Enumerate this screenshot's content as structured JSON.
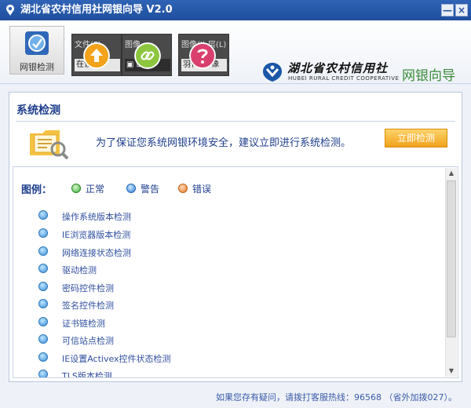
{
  "window": {
    "title": "湖北省农村信用社网银向导 V2.0"
  },
  "title_buttons": {
    "minimize": "—",
    "close": "×"
  },
  "toolbar": {
    "active": {
      "label": "网银检测",
      "icon": "network-check-icon"
    },
    "buttons": [
      {
        "icon": "upload-arrow-icon",
        "color": "#f2a31b",
        "bg_text": "文件(F)",
        "strip_text": "在设置"
      },
      {
        "icon": "link-icon",
        "color": "#8cc63f",
        "bg_text": "图像",
        "strip_text": "▣ ⊡"
      },
      {
        "icon": "help-question-icon",
        "color": "#d9406e",
        "bg_text": "图像(I) 层(L)",
        "strip_text": "羽化: 0 像"
      }
    ]
  },
  "brand": {
    "name_cn": "湖北省农村信用社",
    "name_en": "HUBEI RURAL CREDIT COOPERATIVE",
    "app_name": "网银向导"
  },
  "panel": {
    "title": "系统检测",
    "hint": "为了保证您系统网银环境安全，建议立即进行系统检测。",
    "start_button": "立即检测"
  },
  "legend": {
    "title": "图例：",
    "items": [
      {
        "status": "ok",
        "label": "正常"
      },
      {
        "status": "warn",
        "label": "警告"
      },
      {
        "status": "err",
        "label": "错误"
      }
    ]
  },
  "checks": [
    "操作系统版本检测",
    "IE浏览器版本检测",
    "网络连接状态检测",
    "驱动检测",
    "密码控件检测",
    "签名控件检测",
    "证书链检测",
    "可信站点检测",
    "IE设置Activex控件状态检测",
    "TLS版本检测"
  ],
  "footer": {
    "text": "如果您存有疑问，请拨打客服热线：96568 （省外加拨027）。"
  },
  "colors": {
    "title_bar": "#2f63b5",
    "accent_text": "#1e3e8c",
    "start_button": "#f0a21a",
    "brand_green": "#3a8a3a"
  }
}
